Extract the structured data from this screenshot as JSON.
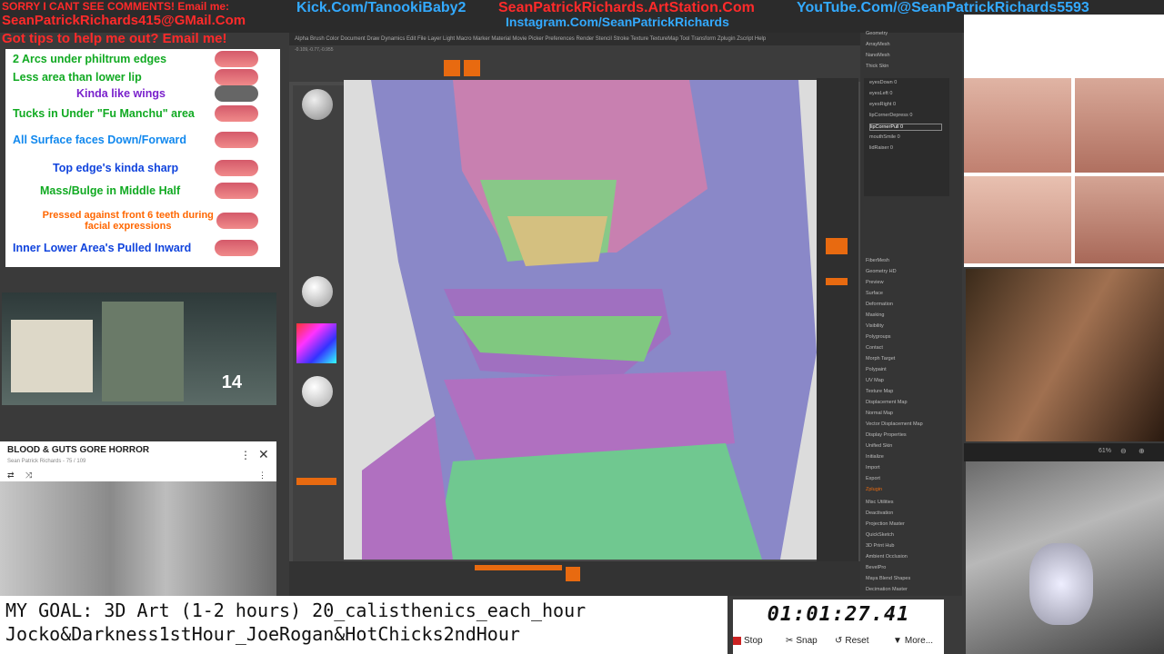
{
  "banner": {
    "comments_warning": "SORRY I CANT SEE COMMENTS! Email me:",
    "kick": "Kick.Com/TanookiBaby2",
    "artstation": "SeanPatrickRichards.ArtStation.Com",
    "youtube": "YouTube.Com/@SeanPatrickRichards5593",
    "instagram": "Instagram.Com/SeanPatrickRichards",
    "email": "SeanPatrickRichards415@GMail.Com",
    "tips": "Got tips to help me out? Email me!"
  },
  "notes": {
    "items": [
      {
        "label": "2 Arcs under philtrum edges",
        "color": "#11aa22"
      },
      {
        "label": "Less area than lower lip",
        "color": "#11aa22"
      },
      {
        "label": "Kinda like wings",
        "color": "#7a22cc"
      },
      {
        "label": "Tucks in Under \"Fu Manchu\" area",
        "color": "#11aa22"
      },
      {
        "label": "All Surface faces Down/Forward",
        "color": "#1188ee"
      },
      {
        "label": "Top edge's kinda sharp",
        "color": "#1144dd"
      },
      {
        "label": "Mass/Bulge in Middle Half",
        "color": "#11aa22"
      },
      {
        "label": "Pressed against front 6 teeth during facial expressions",
        "color": "#ff6600"
      },
      {
        "label": "Inner Lower Area's Pulled Inward",
        "color": "#1144dd"
      }
    ]
  },
  "thumbnail": {
    "count": "14"
  },
  "video_card": {
    "title": "BLOOD & GUTS GORE HORROR",
    "subtitle": "Sean Patrick Richards - 75 / 109"
  },
  "goal": {
    "line1": "MY GOAL: 3D Art (1-2 hours) 20_calisthenics_each_hour",
    "line2": "Jocko&Darkness1stHour_JoeRogan&HotChicks2ndHour"
  },
  "timer": {
    "time": "01:01:27.41",
    "stop": "Stop",
    "snap": "Snap",
    "reset": "Reset",
    "more": "More..."
  },
  "zbrush": {
    "menu": "Alpha  Brush  Color  Document  Draw  Dynamics  Edit  File  Layer  Light  Macro  Marker  Material  Movie  Picker  Preferences  Render  Stencil  Stroke  Texture  TextureMap  Tool  Transform  Zplugin  Zscript  Help",
    "coords": "-0.109,-0.77,-0.955",
    "right_panel": [
      "Geometry",
      "ArrayMesh",
      "NanoMesh",
      "Thick Skin",
      "FiberMesh",
      "Geometry HD",
      "Preview",
      "Surface",
      "Deformation",
      "Masking",
      "Visibility",
      "Polygroups",
      "Contact",
      "Morph Target",
      "Polypaint",
      "UV Map",
      "Texture Map",
      "Displacement Map",
      "Normal Map",
      "Vector Displacement Map",
      "Display Properties",
      "Unified Skin",
      "Initialize",
      "Import",
      "Export",
      "Zplugin",
      "Misc Utilities",
      "Deactivation",
      "Projection Master",
      "QuickSketch",
      "3D Print Hub",
      "Ambient Occlusion",
      "BevelPro",
      "Maya Blend Shapes",
      "Decimation Master"
    ],
    "subtool": [
      "eyesDown 0",
      "eyesLeft 0",
      "eyesRight 0",
      "lipCornerDepress 0",
      "lipCornerPull 0",
      "mouthSmile 0",
      "lidRaiser 0"
    ]
  },
  "right_panel": {
    "zoom": "61%"
  }
}
